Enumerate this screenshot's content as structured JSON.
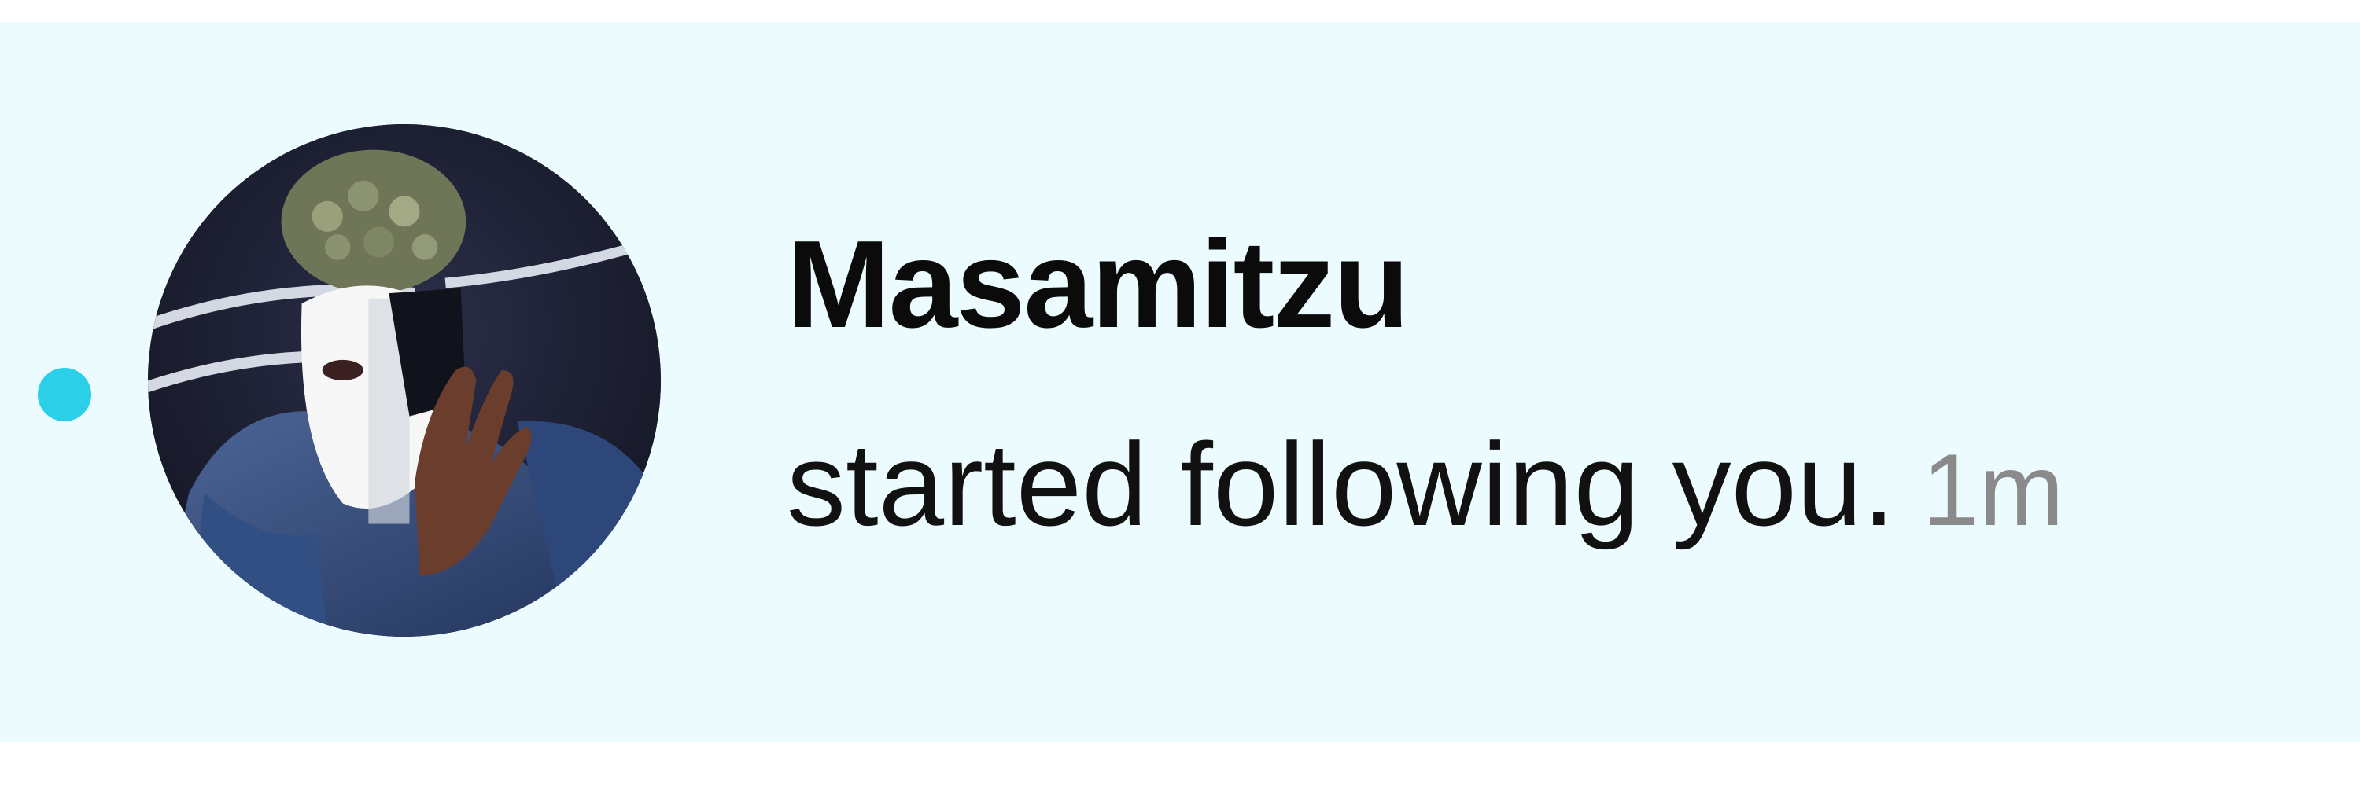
{
  "notification": {
    "unread": true,
    "username": "Masamitzu",
    "action": "started following you.",
    "timestamp": "1m",
    "avatar_icon": "user-avatar-photo"
  },
  "colors": {
    "row_background": "#ecfbfd",
    "unread_dot": "#2bcfe8",
    "username_text": "#0b0b0b",
    "action_text": "#111111",
    "timestamp_text": "#8a8a8a"
  }
}
